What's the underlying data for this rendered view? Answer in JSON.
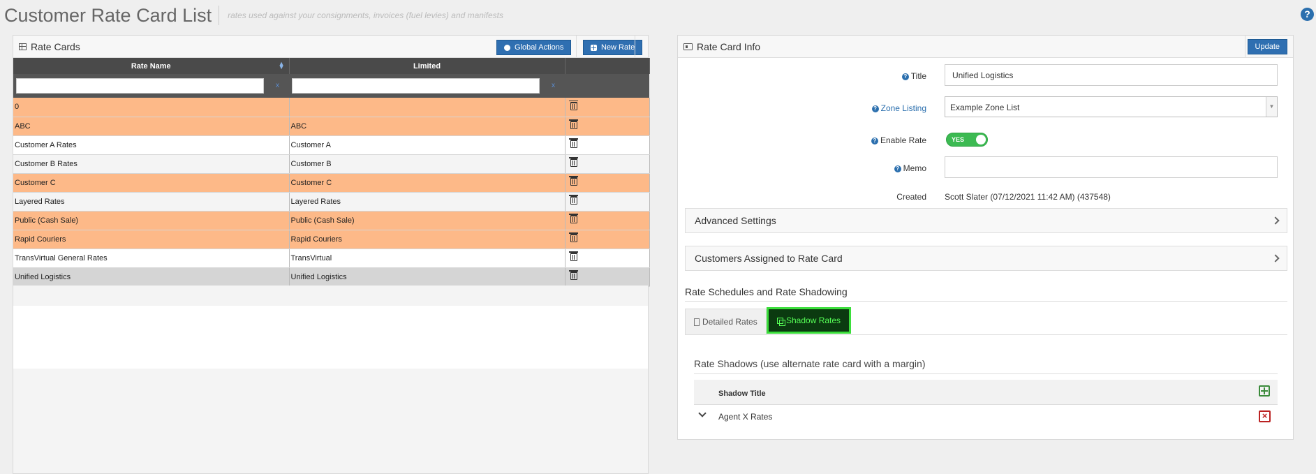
{
  "page": {
    "title": "Customer Rate Card List",
    "subtitle": "rates used against your consignments, invoices (fuel levies) and manifests",
    "help": "?"
  },
  "left_panel": {
    "title": "Rate Cards",
    "global_actions_label": "Global Actions",
    "new_rate_label": "New Rate",
    "columns": [
      "Rate Name",
      "Limited"
    ],
    "filter_clear": "x",
    "rows": [
      {
        "name": "0",
        "limited": "",
        "style": "orange"
      },
      {
        "name": "ABC",
        "limited": "ABC",
        "style": "orange"
      },
      {
        "name": "Customer A Rates",
        "limited": "Customer A",
        "style": "white"
      },
      {
        "name": "Customer B Rates",
        "limited": "Customer B",
        "style": "lgray"
      },
      {
        "name": "Customer C",
        "limited": "Customer C",
        "style": "orange"
      },
      {
        "name": "Layered Rates",
        "limited": "Layered Rates",
        "style": "lgray"
      },
      {
        "name": "Public (Cash Sale)",
        "limited": "Public (Cash Sale)",
        "style": "orange"
      },
      {
        "name": "Rapid Couriers",
        "limited": "Rapid Couriers",
        "style": "orange"
      },
      {
        "name": "TransVirtual General Rates",
        "limited": "TransVirtual",
        "style": "white"
      },
      {
        "name": "Unified Logistics",
        "limited": "Unified Logistics",
        "style": "selected"
      }
    ]
  },
  "right_panel": {
    "title": "Rate Card Info",
    "update_label": "Update",
    "labels": {
      "title": "Title",
      "zone_listing": "Zone Listing",
      "enable_rate": "Enable Rate",
      "memo": "Memo",
      "created": "Created"
    },
    "values": {
      "title": "Unified Logistics",
      "zone_listing": "Example Zone List",
      "enable_rate": "YES",
      "memo": "",
      "created": "Scott Slater (07/12/2021 11:42 AM) (437548)"
    },
    "advanced_settings": "Advanced Settings",
    "customers_assigned": "Customers Assigned to Rate Card",
    "schedules_heading": "Rate Schedules and Rate Shadowing",
    "tabs": {
      "detailed": "Detailed Rates",
      "shadow": "Shadow Rates"
    },
    "shadows": {
      "heading": "Rate Shadows (use alternate rate card with a margin)",
      "column": "Shadow Title",
      "rows": [
        "Agent X Rates"
      ]
    }
  },
  "colors": {
    "accent": "#2f6fb1",
    "row_highlight": "#fdb988",
    "toggle_on": "#3cba52",
    "active_tab_border": "#3bde3b"
  }
}
